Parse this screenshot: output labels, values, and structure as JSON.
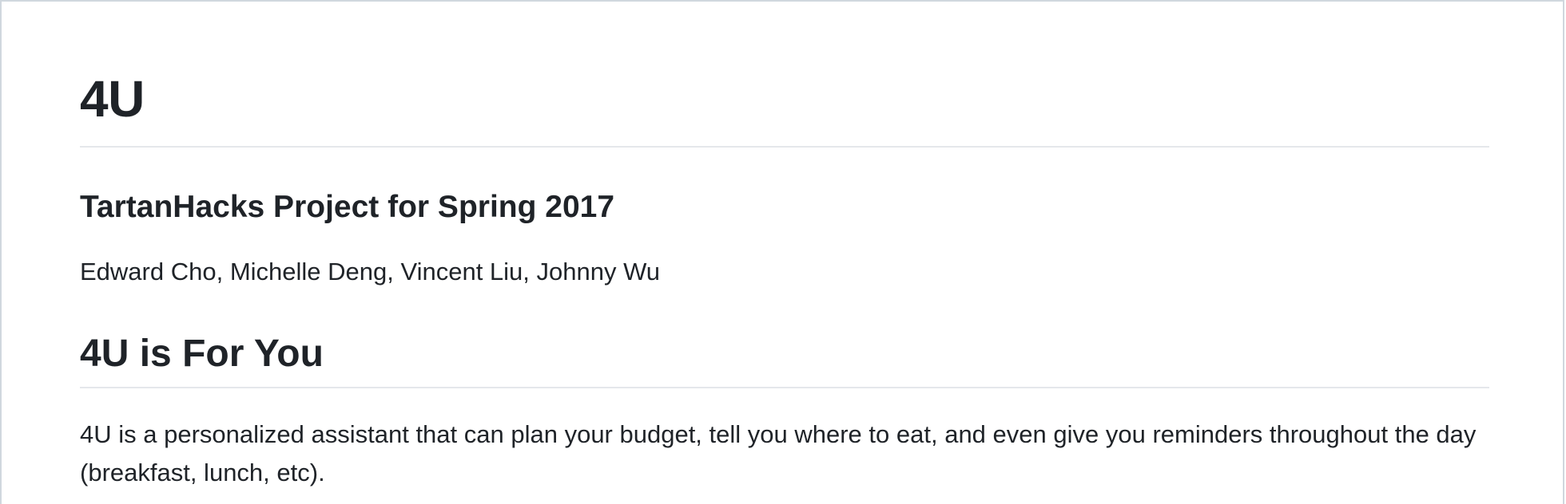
{
  "document": {
    "title": "4U",
    "subtitle": "TartanHacks Project for Spring 2017",
    "authors": "Edward Cho, Michelle Deng, Vincent Liu, Johnny Wu",
    "section": {
      "heading": "4U is For You",
      "body": "4U is a personalized assistant that can plan your budget, tell you where to eat, and even give you reminders throughout the day (breakfast, lunch, etc)."
    }
  }
}
